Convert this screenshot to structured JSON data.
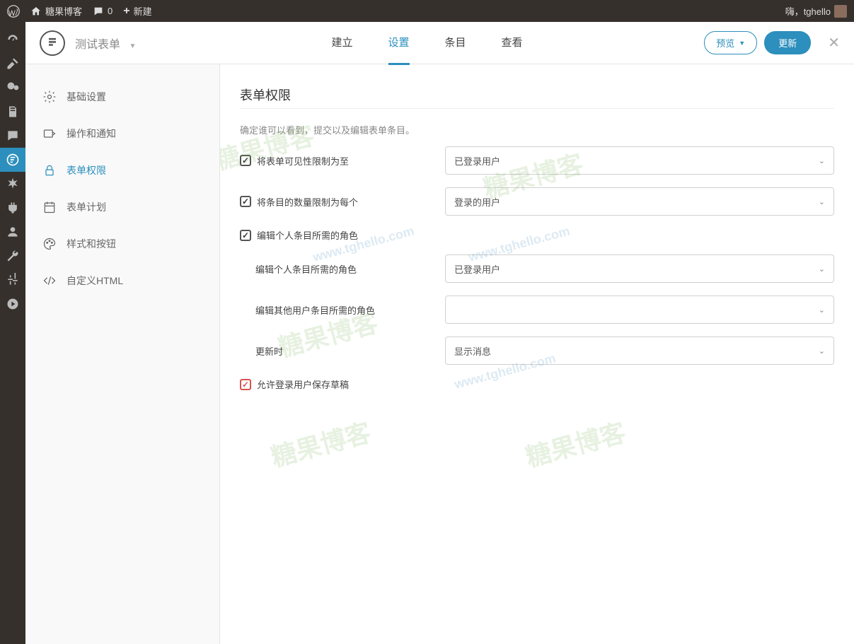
{
  "adminBar": {
    "siteName": "糖果博客",
    "commentsCount": "0",
    "newLabel": "新建",
    "greeting": "嗨，tghello"
  },
  "header": {
    "formName": "测试表单",
    "tabs": [
      "建立",
      "设置",
      "条目",
      "查看"
    ],
    "activeTab": 1,
    "previewLabel": "预览",
    "updateLabel": "更新"
  },
  "settingsNav": {
    "items": [
      {
        "label": "基础设置",
        "icon": "gear"
      },
      {
        "label": "操作和通知",
        "icon": "send"
      },
      {
        "label": "表单权限",
        "icon": "lock"
      },
      {
        "label": "表单计划",
        "icon": "calendar"
      },
      {
        "label": "样式和按钮",
        "icon": "palette"
      },
      {
        "label": "自定义HTML",
        "icon": "code"
      }
    ],
    "activeIndex": 2
  },
  "content": {
    "title": "表单权限",
    "subtitle": "确定谁可以看到，提交以及编辑表单条目。",
    "rows": {
      "limitVisibility": {
        "label": "将表单可见性限制为至",
        "value": "已登录用户"
      },
      "limitEntries": {
        "label": "将条目的数量限制为每个",
        "value": "登录的用户"
      },
      "roleRequired": {
        "label": "编辑个人条目所需的角色"
      },
      "editOwnRole": {
        "label": "编辑个人条目所需的角色",
        "value": "已登录用户"
      },
      "editOthersRole": {
        "label": "编辑其他用户条目所需的角色",
        "value": ""
      },
      "onUpdate": {
        "label": "更新时",
        "value": "显示消息"
      },
      "allowDraft": {
        "label": "允许登录用户保存草稿"
      }
    }
  },
  "watermark": {
    "text": "糖果博客",
    "url": "www.tghello.com"
  }
}
